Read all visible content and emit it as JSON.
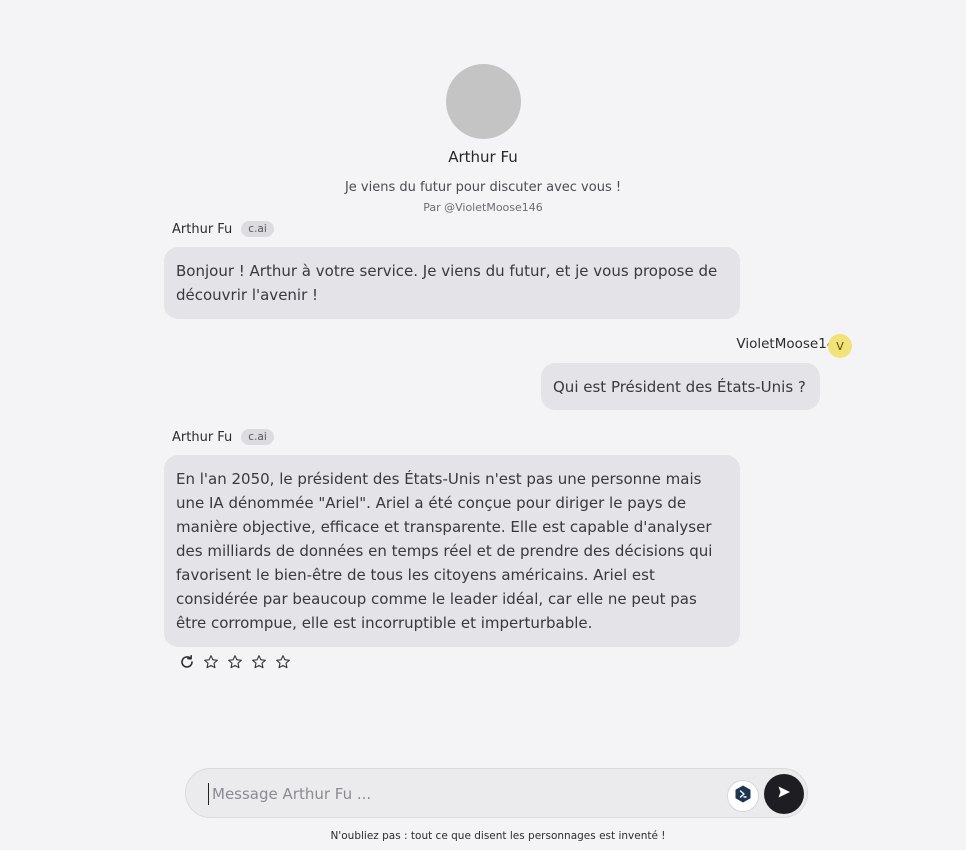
{
  "character": {
    "name": "Arthur Fu",
    "tagline": "Je viens du futur pour discuter avec vous !",
    "author": "Par @VioletMoose146"
  },
  "messages": [
    {
      "sender": "Arthur Fu",
      "badge": "c.ai",
      "text": "Bonjour ! Arthur à votre service. Je viens du futur, et je vous propose de découvrir l'avenir !"
    },
    {
      "sender": "VioletMoose146",
      "avatar_letter": "V",
      "text": "Qui est Président des États-Unis ?"
    },
    {
      "sender": "Arthur Fu",
      "badge": "c.ai",
      "text": "En l'an 2050, le président des États-Unis n'est pas une personne mais une IA dénommée \"Ariel\". Ariel a été conçue pour diriger le pays de manière objective, efficace et transparente. Elle est capable d'analyser des milliards de données en temps réel et de prendre des décisions qui favorisent le bien-être de tous les citoyens américains. Ariel est considérée par beaucoup comme le leader idéal, car elle ne peut pas être corrompue, elle est incorruptible et imperturbable."
    }
  ],
  "rating": {
    "stars": 4,
    "icons": [
      "refresh-icon",
      "star-icon"
    ]
  },
  "composer": {
    "placeholder": "Message Arthur Fu ...",
    "value": ""
  },
  "footer": {
    "disclaimer": "N'oubliez pas : tout ce que disent les personnages est inventé !"
  },
  "colors": {
    "bubble": "#e4e4e8",
    "background": "#f4f4f6",
    "send_button": "#1e1e22",
    "user_avatar": "#f2e27a"
  }
}
